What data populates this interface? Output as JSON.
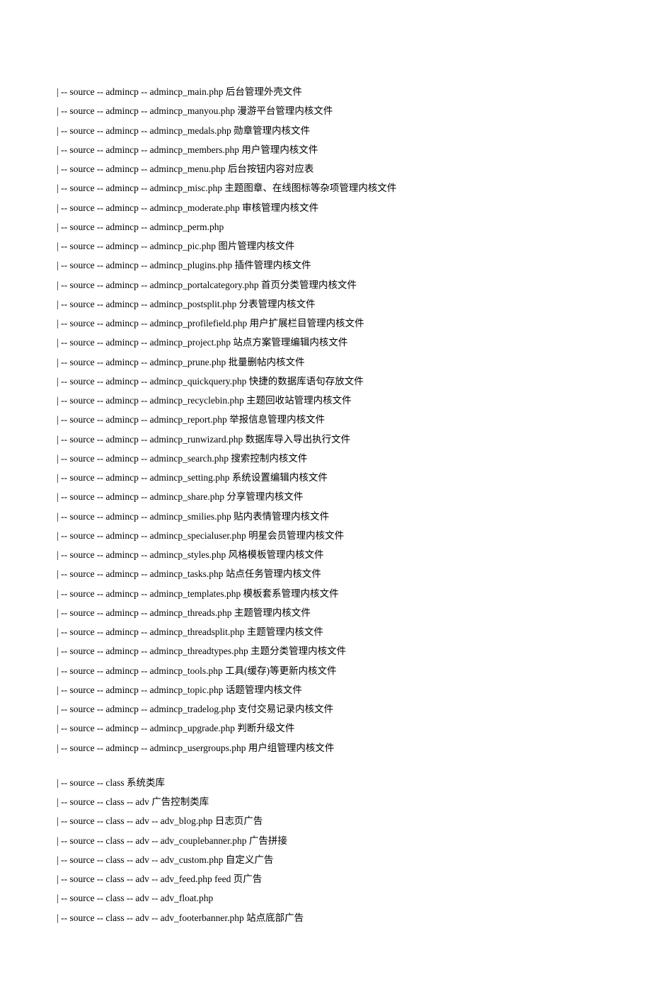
{
  "group1": [
    {
      "path": "| -- source    -- admincp --    admincp_main.php",
      "desc": "后台管理外壳文件"
    },
    {
      "path": "| -- source    -- admincp --    admincp_manyou.php",
      "desc": "漫游平台管理内核文件"
    },
    {
      "path": "| -- source    -- admincp --    admincp_medals.php",
      "desc": "勋章管理内核文件"
    },
    {
      "path": "| -- source    -- admincp --    admincp_members.php",
      "desc": "用户管理内核文件"
    },
    {
      "path": "| -- source    -- admincp --    admincp_menu.php",
      "desc": "后台按钮内容对应表"
    },
    {
      "path": "| -- source    -- admincp --    admincp_misc.php",
      "desc": "主题图章、在线图标等杂项管理内核文件"
    },
    {
      "path": "| -- source    -- admincp --    admincp_moderate.php",
      "desc": "审核管理内核文件"
    },
    {
      "path": "| -- source    -- admincp --    admincp_perm.php",
      "desc": ""
    },
    {
      "path": "| -- source    -- admincp --    admincp_pic.php",
      "desc": "图片管理内核文件"
    },
    {
      "path": "| -- source    -- admincp --    admincp_plugins.php",
      "desc": "插件管理内核文件"
    },
    {
      "path": "| -- source    -- admincp --    admincp_portalcategory.php",
      "desc": "首页分类管理内核文件"
    },
    {
      "path": "| -- source    -- admincp --    admincp_postsplit.php",
      "desc": "分表管理内核文件"
    },
    {
      "path": "| -- source    -- admincp --    admincp_profilefield.php",
      "desc": "用户扩展栏目管理内核文件"
    },
    {
      "path": "| -- source    -- admincp --    admincp_project.php",
      "desc": "站点方案管理编辑内核文件"
    },
    {
      "path": "| -- source    -- admincp --    admincp_prune.php",
      "desc": "批量删帖内核文件"
    },
    {
      "path": "| -- source    -- admincp -- admincp_quickquery.php",
      "desc": "快捷的数据库语句存放文件"
    },
    {
      "path": "| -- source    -- admincp --    admincp_recyclebin.php",
      "desc": "主题回收站管理内核文件"
    },
    {
      "path": "| -- source    -- admincp --    admincp_report.php",
      "desc": "举报信息管理内核文件"
    },
    {
      "path": "| -- source    -- admincp --    admincp_runwizard.php",
      "desc": "数据库导入导出执行文件"
    },
    {
      "path": "| -- source    -- admincp --    admincp_search.php",
      "desc": "搜索控制内核文件"
    },
    {
      "path": "| -- source    -- admincp --    admincp_setting.php",
      "desc": "系统设置编辑内核文件"
    },
    {
      "path": "| -- source    -- admincp --    admincp_share.php",
      "desc": "分享管理内核文件"
    },
    {
      "path": "| -- source    -- admincp --    admincp_smilies.php",
      "desc": "贴内表情管理内核文件"
    },
    {
      "path": "| -- source    -- admincp --    admincp_specialuser.php",
      "desc": "明星会员管理内核文件"
    },
    {
      "path": "| -- source    -- admincp --    admincp_styles.php",
      "desc": "风格模板管理内核文件"
    },
    {
      "path": "| -- source    -- admincp --    admincp_tasks.php",
      "desc": "站点任务管理内核文件"
    },
    {
      "path": "| -- source    -- admincp --    admincp_templates.php",
      "desc": "模板套系管理内核文件"
    },
    {
      "path": "| -- source    -- admincp --    admincp_threads.php",
      "desc": "主题管理内核文件"
    },
    {
      "path": "| -- source    -- admincp --    admincp_threadsplit.php",
      "desc": "主题管理内核文件"
    },
    {
      "path": "| -- source    -- admincp --    admincp_threadtypes.php",
      "desc": "主题分类管理内核文件"
    },
    {
      "path": "| -- source    -- admincp --    admincp_tools.php",
      "desc": "工具(缓存)等更新内核文件"
    },
    {
      "path": "| -- source    -- admincp --    admincp_topic.php",
      "desc": "话题管理内核文件"
    },
    {
      "path": "| -- source    -- admincp --    admincp_tradelog.php",
      "desc": "支付交易记录内核文件"
    },
    {
      "path": "| -- source    -- admincp --    admincp_upgrade.php",
      "desc": "判断升级文件"
    },
    {
      "path": "| -- source    -- admincp --    admincp_usergroups.php",
      "desc": "用户组管理内核文件"
    }
  ],
  "group2": [
    {
      "path": "| -- source    -- class",
      "desc": "系统类库"
    },
    {
      "path": "| -- source    -- class    --    adv",
      "desc": "广告控制类库"
    },
    {
      "path": "| -- source    -- class    --    adv    --    adv_blog.php",
      "desc": "日志页广告"
    },
    {
      "path": "| -- source    -- class    --    adv    --    adv_couplebanner.php",
      "desc": "广告拼接"
    },
    {
      "path": "| -- source    -- class    --    adv    --    adv_custom.php",
      "desc": "自定义广告"
    },
    {
      "path": "| -- source    -- class    --    adv    --    adv_feed.php",
      "desc": "feed 页广告"
    },
    {
      "path": "| -- source    -- class    --    adv    --    adv_float.php",
      "desc": ""
    },
    {
      "path": "| -- source    -- class    --    adv    --    adv_footerbanner.php",
      "desc": "站点底部广告"
    }
  ]
}
